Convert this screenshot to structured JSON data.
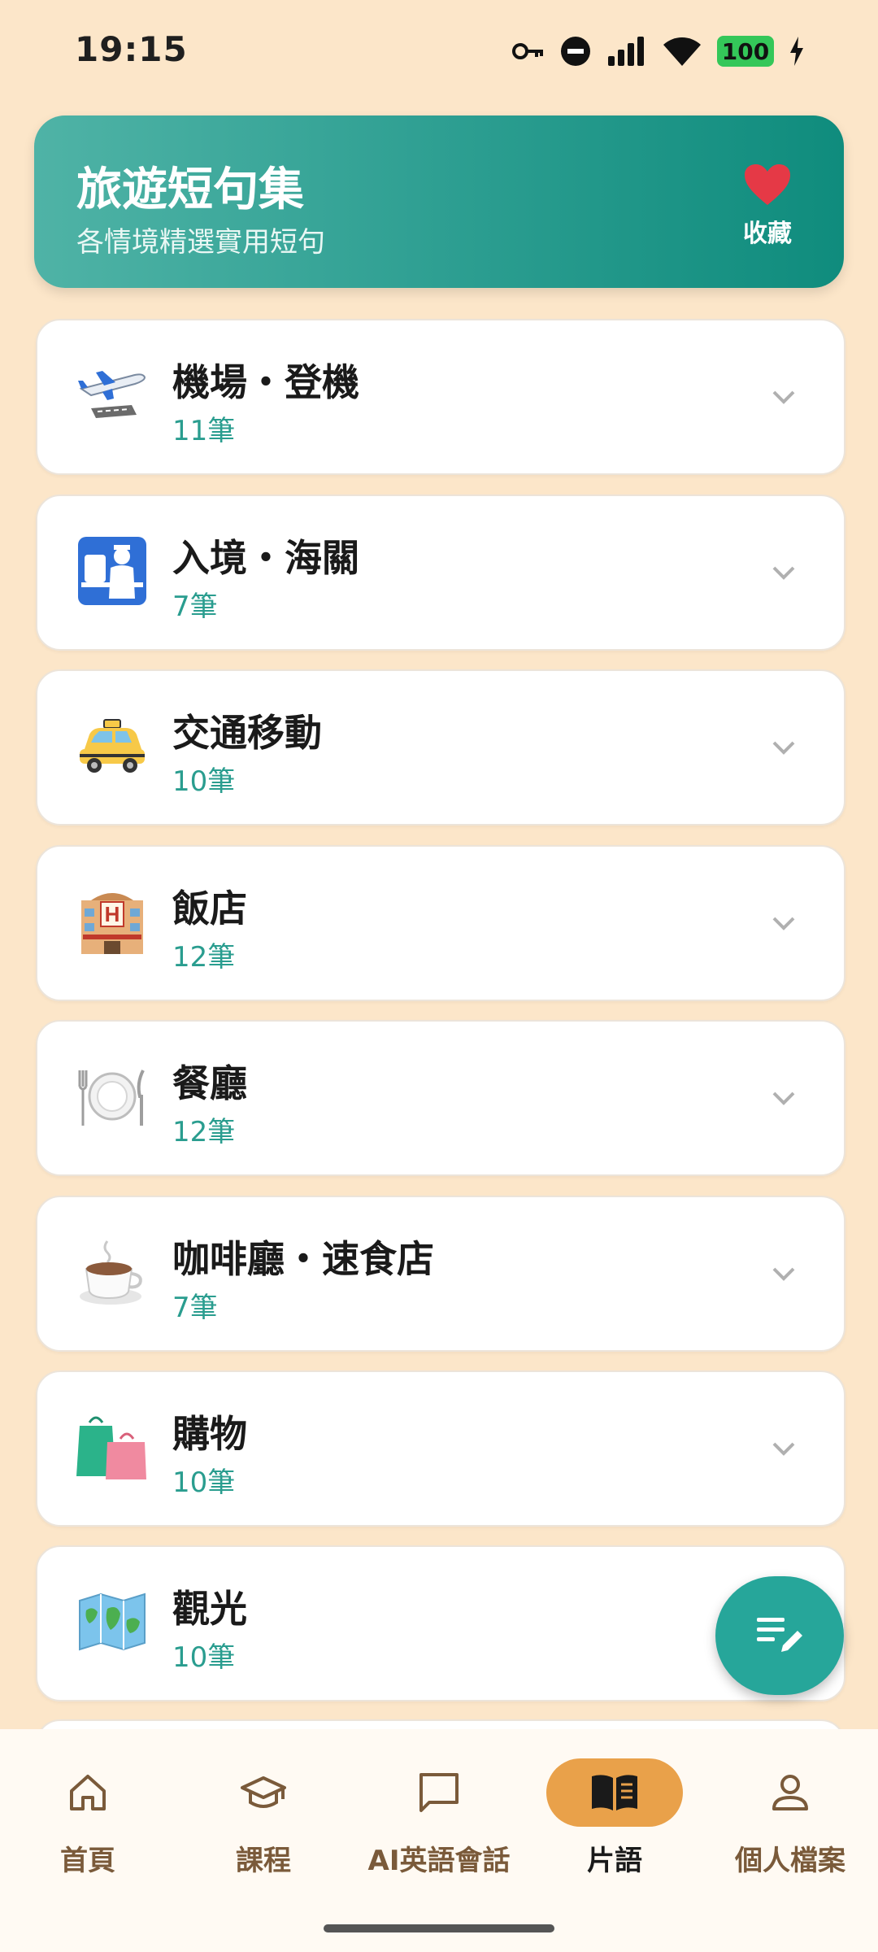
{
  "status_bar": {
    "time": "19:15",
    "battery": "100"
  },
  "header": {
    "title": "旅遊短句集",
    "subtitle": "各情境精選實用短句",
    "favorite_label": "收藏"
  },
  "categories": [
    {
      "name": "機場・登機",
      "count": "11筆",
      "icon": "airplane-icon"
    },
    {
      "name": "入境・海關",
      "count": "7筆",
      "icon": "passport-control-icon"
    },
    {
      "name": "交通移動",
      "count": "10筆",
      "icon": "taxi-icon"
    },
    {
      "name": "飯店",
      "count": "12筆",
      "icon": "hotel-icon"
    },
    {
      "name": "餐廳",
      "count": "12筆",
      "icon": "plate-cutlery-icon"
    },
    {
      "name": "咖啡廳・速食店",
      "count": "7筆",
      "icon": "coffee-icon"
    },
    {
      "name": "購物",
      "count": "10筆",
      "icon": "shopping-bags-icon"
    },
    {
      "name": "觀光",
      "count": "10筆",
      "icon": "map-icon"
    }
  ],
  "bottom_nav": [
    {
      "label": "首頁",
      "icon": "home-icon",
      "active": false
    },
    {
      "label": "課程",
      "icon": "graduation-cap-icon",
      "active": false
    },
    {
      "label": "AI英語會話",
      "icon": "chat-bubble-icon",
      "active": false
    },
    {
      "label": "片語",
      "icon": "book-icon",
      "active": true
    },
    {
      "label": "個人檔案",
      "icon": "person-icon",
      "active": false
    }
  ],
  "colors": {
    "background": "#fce6c9",
    "teal": "#26a69a",
    "active_nav": "#e9a14a"
  }
}
